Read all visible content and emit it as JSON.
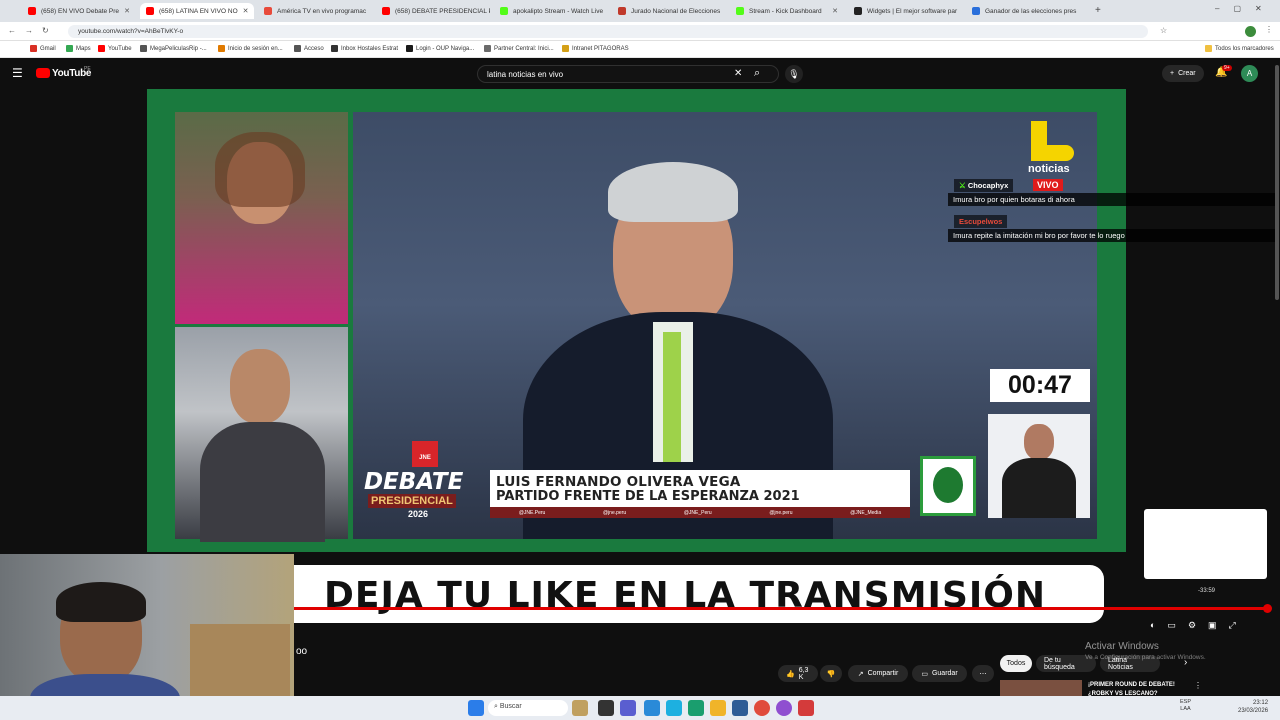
{
  "browser": {
    "tabs": [
      {
        "title": "(658) EN VIVO Debate Pre",
        "favicon": "youtube",
        "color": "#ff0000"
      },
      {
        "title": "(658) LATINA EN VIVO NO",
        "favicon": "youtube",
        "color": "#ff0000",
        "active": true
      },
      {
        "title": "América TV en vivo programac",
        "favicon": "america",
        "color": "#e84a3a"
      },
      {
        "title": "(658) DEBATE PRESIDENCIAL PE",
        "favicon": "youtube",
        "color": "#ff0000"
      },
      {
        "title": "apokalipto Stream - Watch Live",
        "favicon": "kick",
        "color": "#53fc18"
      },
      {
        "title": "Jurado Nacional de Elecciones",
        "favicon": "jne",
        "color": "#c0392b"
      },
      {
        "title": "Stream - Kick Dashboard",
        "favicon": "kick",
        "color": "#53fc18"
      },
      {
        "title": "Widgets | El mejor software par",
        "favicon": "streamelements",
        "color": "#222222"
      },
      {
        "title": "Ganador de las elecciones pres",
        "favicon": "news",
        "color": "#2a6fdb"
      }
    ],
    "url": "youtube.com/watch?v=AhBeTlvKY-o",
    "bookmarks": [
      "Gmail",
      "Maps",
      "YouTube",
      "MegaPeliculasRip -...",
      "Inicio de sesión en...",
      "Acceso",
      "Inbox Hostales Estrat",
      "Login - OUP Naviga...",
      "Partner Central: Inici...",
      "Intranet PITAGORAS"
    ],
    "all_bookmarks": "Todos los marcadores"
  },
  "youtube": {
    "logo": "YouTube",
    "country": "PE",
    "search_query": "latina noticias en vivo",
    "create_label": "Crear",
    "notif_count": "9+",
    "avatar_letter": "A"
  },
  "video": {
    "brand": "noticias",
    "live": "VIVO",
    "timer": "00:47",
    "debate_title": "DEBATE",
    "debate_sub": "PRESIDENCIAL",
    "debate_year": "2026",
    "jne": "JNE",
    "candidate_name": "LUIS FERNANDO OLIVERA VEGA",
    "candidate_party": "PARTIDO FRENTE DE LA ESPERANZA 2021",
    "socials": [
      "@JNE.Peru",
      "@jne.peru",
      "@JNE_Peru",
      "@jne.peru",
      "@JNE_Media"
    ],
    "time_remaining": "-33:59"
  },
  "chat": [
    {
      "user": "Chocaphyx",
      "text": "Imura bro por quien botaras di ahora",
      "color": "#ffffff"
    },
    {
      "user": "Escupelwos",
      "text": "Imura repite la imitación mi bro por favor te lo ruego",
      "color": "#e84a3a"
    }
  ],
  "banner": "DEJA TU LIKE EN LA TRANSMISIÓN",
  "below": {
    "likes": "6,3 K",
    "share": "Compartir",
    "save": "Guardar",
    "chips": [
      "Todos",
      "De tu búsqueda",
      "Latina Noticias"
    ],
    "rec_title": "¡PRIMER ROUND DE DEBATE! ¿ROBKY VS LESCANO?",
    "partial": "oo"
  },
  "watermark": {
    "line1": "Activar Windows",
    "line2": "Ve a Configuración para activar Windows."
  },
  "taskbar": {
    "search": "Buscar",
    "lang1": "ESP",
    "lang2": "LAA",
    "time": "23:12",
    "date": "23/03/2026"
  }
}
